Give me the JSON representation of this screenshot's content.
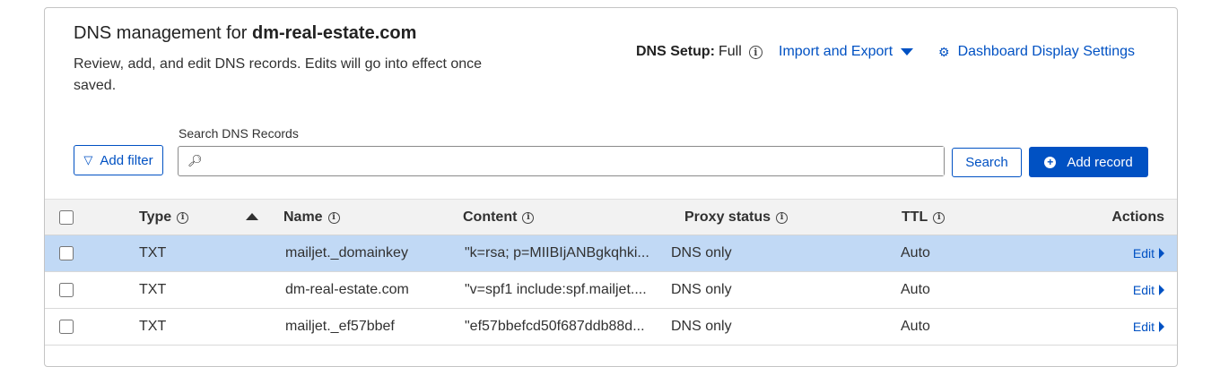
{
  "header": {
    "title_prefix": "DNS management for ",
    "domain": "dm-real-estate.com",
    "description": "Review, add, and edit DNS records. Edits will go into effect once saved.",
    "dns_setup_label": "DNS Setup:",
    "dns_setup_value": "Full",
    "import_export_label": "Import and Export",
    "dashboard_settings_label": "Dashboard Display Settings"
  },
  "toolbar": {
    "add_filter_label": "Add filter",
    "search_label": "Search DNS Records",
    "search_value": "",
    "search_button_label": "Search",
    "add_record_label": "Add record"
  },
  "table": {
    "columns": {
      "type": "Type",
      "name": "Name",
      "content": "Content",
      "proxy_status": "Proxy status",
      "ttl": "TTL",
      "actions": "Actions"
    },
    "sort_column": "Type",
    "sort_direction": "ascending",
    "rows": [
      {
        "type": "TXT",
        "name": "mailjet._domainkey",
        "content": "\"k=rsa; p=MIIBIjANBgkqhki...",
        "proxy": "DNS only",
        "ttl": "Auto",
        "action": "Edit",
        "selected": true
      },
      {
        "type": "TXT",
        "name": "dm-real-estate.com",
        "content": "\"v=spf1 include:spf.mailjet....",
        "proxy": "DNS only",
        "ttl": "Auto",
        "action": "Edit",
        "selected": false
      },
      {
        "type": "TXT",
        "name": "mailjet._ef57bbef",
        "content": "\"ef57bbefcd50f687ddb88d...",
        "proxy": "DNS only",
        "ttl": "Auto",
        "action": "Edit",
        "selected": false
      }
    ]
  },
  "colors": {
    "accent": "#0051c3",
    "selected_row": "#c1d9f5",
    "header_bg": "#f2f2f2"
  },
  "icons": [
    "info-icon",
    "chevron-down-icon",
    "gear-icon",
    "filter-icon",
    "search-icon",
    "plus-circle-icon",
    "sort-ascending-icon",
    "chevron-right-icon"
  ]
}
